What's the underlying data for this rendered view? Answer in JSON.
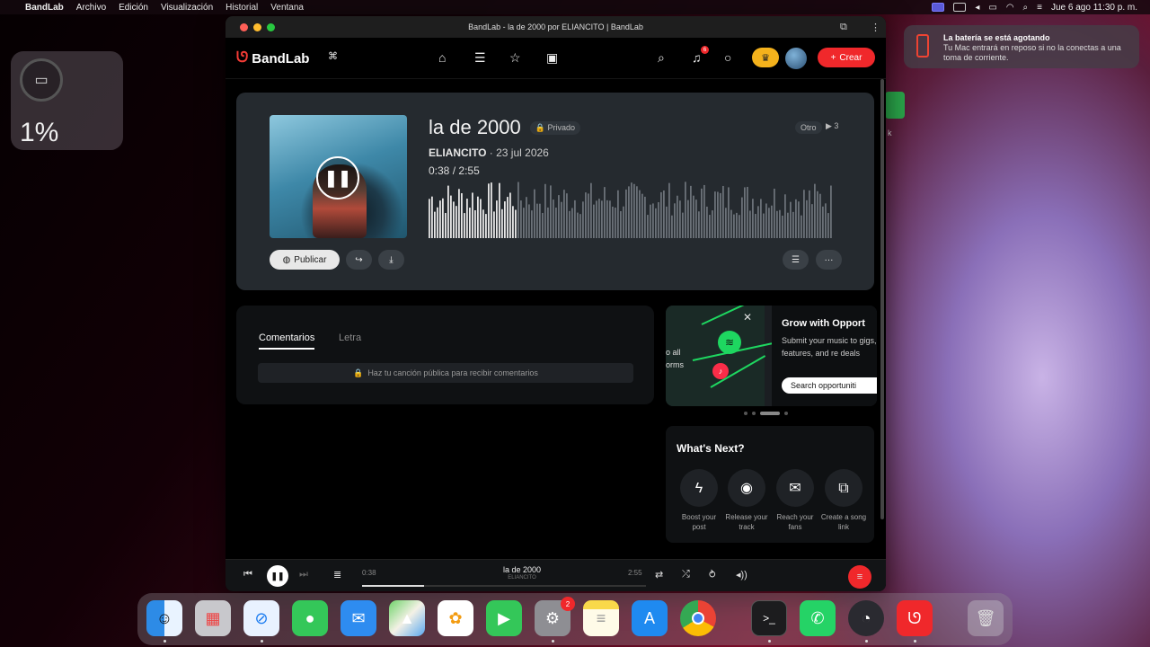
{
  "menubar": {
    "app": "BandLab",
    "menus": [
      "Archivo",
      "Edición",
      "Visualización",
      "Historial",
      "Ventana"
    ],
    "datetime": "Jue 6 ago  11:30 p. m."
  },
  "battery_widget": {
    "percent": "1%"
  },
  "notification": {
    "title": "La batería se está agotando",
    "message": "Tu Mac entrará en reposo si no la conectas a una toma de corriente."
  },
  "desktop": {
    "partial_label": "k"
  },
  "window": {
    "title": "BandLab - la de 2000 por ELIANCITO | BandLab"
  },
  "nav": {
    "logo": "BandLab",
    "notification_count": "6",
    "create_label": "Crear"
  },
  "track": {
    "title": "la de 2000",
    "privacy": "Privado",
    "artist": "ELIANCITO",
    "date": "· 23 jul 2026",
    "time_current": "0:38",
    "time_separator": "/",
    "time_total": "2:55",
    "genre": "Otro",
    "plays": "3",
    "progress": 0.217,
    "publish_label": "Publicar"
  },
  "comments": {
    "tabs": [
      "Comentarios",
      "Letra"
    ],
    "message": "Haz tu canción pública para recibir comentarios"
  },
  "promo": {
    "side_text": "o all\norms",
    "title": "Grow with Opport",
    "text": "Submit your music to gigs, features, and re deals",
    "button": "Search opportuniti"
  },
  "whats_next": {
    "title": "What's Next?",
    "items": [
      {
        "icon": "bolt-icon",
        "label": "Boost your post"
      },
      {
        "icon": "release-icon",
        "label": "Release your track"
      },
      {
        "icon": "mail-icon",
        "label": "Reach your fans"
      },
      {
        "icon": "link-icon",
        "label": "Create a song link"
      }
    ]
  },
  "player": {
    "current": "0:38",
    "total": "2:55",
    "title": "la de 2000",
    "artist": "ELIANCITO",
    "progress": 0.217
  },
  "dock": {
    "apps": [
      "Finder",
      "Launchpad",
      "Safari",
      "Messages",
      "Mail",
      "Maps",
      "Photos",
      "FaceTime",
      "System Settings",
      "Notes",
      "App Store",
      "Chrome",
      "Terminal",
      "WhatsApp",
      "OBS",
      "BandLab",
      "Trash"
    ],
    "settings_badge": "2"
  },
  "colors": {
    "accent": "#f0282b",
    "premium": "#f4b21c",
    "spotify": "#1ed760"
  }
}
